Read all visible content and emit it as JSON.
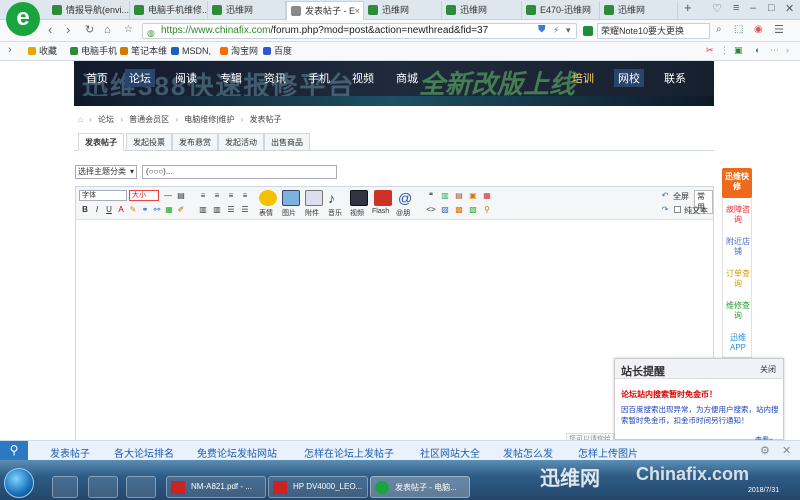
{
  "browser": {
    "tabs": [
      {
        "label": "情报导航(envi...",
        "active": false
      },
      {
        "label": "电脑手机维修...",
        "active": false
      },
      {
        "label": "迅维网",
        "active": false
      },
      {
        "label": "发表帖子 - E",
        "active": true
      },
      {
        "label": "迅维网",
        "active": false
      },
      {
        "label": "迅维网",
        "active": false
      },
      {
        "label": "E470-迅维网",
        "active": false
      },
      {
        "label": "迅维网",
        "active": false
      }
    ],
    "new_tab": "+",
    "url": "https://www.chinafix.com/forum.php?mod=post&action=newthread&fid=37",
    "url_domain": "https://www.chinafix.com",
    "url_path": "/forum.php?mod=post&action=newthread&fid=37",
    "search_text": "荣耀Note10要大更换",
    "bookmarks": [
      {
        "label": "收藏",
        "color": "#e6a800"
      },
      {
        "label": "电脑手机",
        "color": "#2e8b3a"
      },
      {
        "label": "笔记本维",
        "color": "#d47a00"
      },
      {
        "label": "MSDN,",
        "color": "#1f5fbf"
      },
      {
        "label": "淘宝网",
        "color": "#ff6a00"
      },
      {
        "label": "百度",
        "color": "#2f55d4"
      }
    ]
  },
  "site": {
    "nav": [
      "首页",
      "论坛",
      "阅读",
      "专辑",
      "资讯",
      "手机",
      "视频",
      "商城",
      "培训",
      "网校",
      "联系"
    ],
    "banner_text": "迅维388快速报修平台",
    "banner_text2": "全新改版上线"
  },
  "breadcrumb": [
    "论坛",
    "普通会员区",
    "电脑维修|维护",
    "发表帖子"
  ],
  "post_tabs": [
    "发表帖子",
    "发起投票",
    "发布悬赏",
    "发起活动",
    "出售商品"
  ],
  "topic": {
    "select_label": "选择主题分类",
    "title_value": "(○○○)..."
  },
  "editor": {
    "font_label": "字体",
    "size_label": "大小",
    "tools": [
      "表情",
      "图片",
      "附件",
      "音乐",
      "视频",
      "Flash",
      "@朋"
    ],
    "right_tools": [
      "全屏",
      "常用"
    ],
    "plain_text": "纯文本",
    "bottom_hint": "您可以请你给"
  },
  "floatnav": {
    "head": "迅维快修",
    "items": [
      {
        "label": "故障咨询",
        "color": "#e23"
      },
      {
        "label": "附近店铺",
        "color": "#4a6bd4"
      },
      {
        "label": "订单查询",
        "color": "#d89b00"
      },
      {
        "label": "维修查询",
        "color": "#2aa12a"
      },
      {
        "label": "迅维APP",
        "color": "#1d8fd6"
      }
    ]
  },
  "notice": {
    "title": "站长提醒",
    "close": "关闭",
    "headline": "论坛站内搜索暂时免金币！",
    "body": "因百度搜索出现异常，为方便用户搜索，站内搜索暂时免金币，扣金币时间另行通知！",
    "more": "查看»"
  },
  "related": [
    "发表帖子",
    "各大论坛排名",
    "免费论坛发帖网站",
    "怎样在论坛上发帖子",
    "社区网站大全",
    "发帖怎么发",
    "怎样上传图片"
  ],
  "taskbar": {
    "items": [
      {
        "label": "NM-A821.pdf - ...",
        "active": false
      },
      {
        "label": "HP DV4000_LEO...",
        "active": false
      },
      {
        "label": "发表帖子 - 电脑...",
        "active": true
      }
    ],
    "date": "2018/7/31",
    "watermark": "迅维网",
    "watermark2": "Chinafix.com"
  }
}
